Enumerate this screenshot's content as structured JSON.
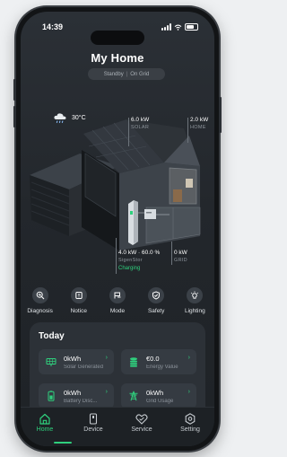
{
  "status": {
    "time": "14:39"
  },
  "header": {
    "title": "My Home",
    "mode": [
      "Standby",
      "On Grid"
    ],
    "mode_separator": "|"
  },
  "weather": {
    "temp": "30°C",
    "icon": "cloud-rain-icon"
  },
  "metrics": {
    "solar": {
      "value": "6.0 kW",
      "label": "SOLAR"
    },
    "home": {
      "value": "2.0 kW",
      "label": "HOME"
    },
    "battery": {
      "value": "4.0 kW · 60.0 %",
      "label": "SigenStor",
      "status": "Charging"
    },
    "grid": {
      "value": "0 kW",
      "label": "GRID"
    }
  },
  "actions": [
    {
      "label": "Diagnosis",
      "icon": "diagnosis-icon"
    },
    {
      "label": "Notice",
      "icon": "notice-icon"
    },
    {
      "label": "Mode",
      "icon": "mode-icon"
    },
    {
      "label": "Safety",
      "icon": "safety-icon"
    },
    {
      "label": "Lighting",
      "icon": "lighting-icon"
    }
  ],
  "today": {
    "title": "Today",
    "cards": [
      {
        "value": "0kWh",
        "caption": "Solar Generated",
        "icon": "solar-panel-icon"
      },
      {
        "value": "€0.0",
        "caption": "Energy Value",
        "icon": "coins-icon"
      },
      {
        "value": "0kWh",
        "caption": "Battery Disc...",
        "icon": "battery-icon"
      },
      {
        "value": "0kWh",
        "caption": "Grid Usage",
        "icon": "grid-tower-icon"
      }
    ]
  },
  "tabs": [
    {
      "label": "Home",
      "icon": "home-icon",
      "active": true
    },
    {
      "label": "Device",
      "icon": "device-icon",
      "active": false
    },
    {
      "label": "Service",
      "icon": "service-icon",
      "active": false
    },
    {
      "label": "Setting",
      "icon": "setting-icon",
      "active": false
    }
  ],
  "colors": {
    "accent": "#2fd07d",
    "background": "#23272c",
    "card": "#2c3137"
  }
}
